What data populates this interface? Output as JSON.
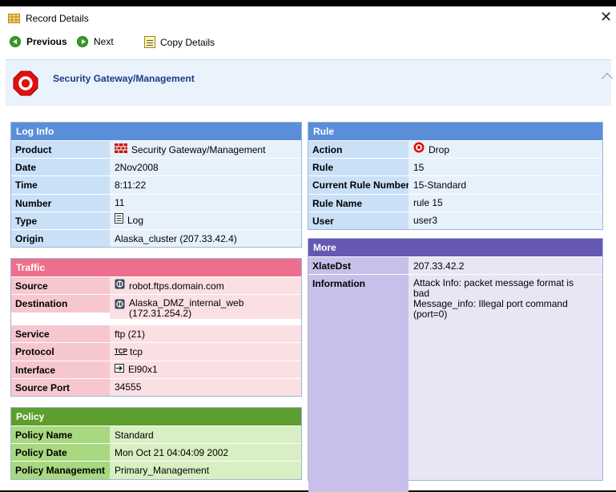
{
  "window": {
    "title": "Record Details",
    "close_glyph": "✕"
  },
  "toolbar": {
    "previous": "Previous",
    "next": "Next",
    "copy": "Copy Details"
  },
  "header": {
    "title": "Security Gateway/Management"
  },
  "loginfo": {
    "heading": "Log Info",
    "rows": [
      {
        "key": "Product",
        "value": "Security Gateway/Management",
        "icon": "firewall-icon"
      },
      {
        "key": "Date",
        "value": "2Nov2008"
      },
      {
        "key": "Time",
        "value": "8:11:22"
      },
      {
        "key": "Number",
        "value": "11"
      },
      {
        "key": "Type",
        "value": "Log",
        "icon": "log-icon"
      },
      {
        "key": "Origin",
        "value": "Alaska_cluster (207.33.42.4)"
      }
    ]
  },
  "traffic": {
    "heading": "Traffic",
    "rows": [
      {
        "key": "Source",
        "value": "robot.ftps.domain.com",
        "icon": "host-icon"
      },
      {
        "key": "Destination",
        "value": "Alaska_DMZ_internal_web",
        "value2": "(172.31.254.2)",
        "icon": "host-icon"
      },
      {
        "key": "Service",
        "value": "ftp (21)"
      },
      {
        "key": "Protocol",
        "value": "tcp",
        "icon_text": "TCP"
      },
      {
        "key": "Interface",
        "value": "El90x1",
        "icon": "interface-icon"
      },
      {
        "key": "Source Port",
        "value": "34555"
      }
    ]
  },
  "policy": {
    "heading": "Policy",
    "rows": [
      {
        "key": "Policy Name",
        "value": "Standard"
      },
      {
        "key": "Policy Date",
        "value": "Mon Oct 21 04:04:09 2002"
      },
      {
        "key": "Policy Management",
        "value": "Primary_Management"
      }
    ]
  },
  "rule": {
    "heading": "Rule",
    "rows": [
      {
        "key": "Action",
        "value": "Drop",
        "icon": "drop-icon"
      },
      {
        "key": "Rule",
        "value": "15"
      },
      {
        "key": "Current Rule Number",
        "value": "15-Standard"
      },
      {
        "key": "Rule Name",
        "value": "rule 15"
      },
      {
        "key": "User",
        "value": "user3"
      }
    ]
  },
  "more": {
    "heading": "More",
    "rows": [
      {
        "key": "XlateDst",
        "value": "207.33.42.2"
      },
      {
        "key": "Information",
        "lines": [
          "Attack Info: packet message format is",
          "bad",
          "Message_info: Illegal port command",
          "(port=0)"
        ]
      }
    ]
  },
  "colors": {
    "loginfo_header": "#5b8ed8",
    "traffic_header": "#ee6f8b",
    "policy_header": "#5d9e2f",
    "more_header": "#6659b3",
    "drop_red": "#e01010"
  }
}
